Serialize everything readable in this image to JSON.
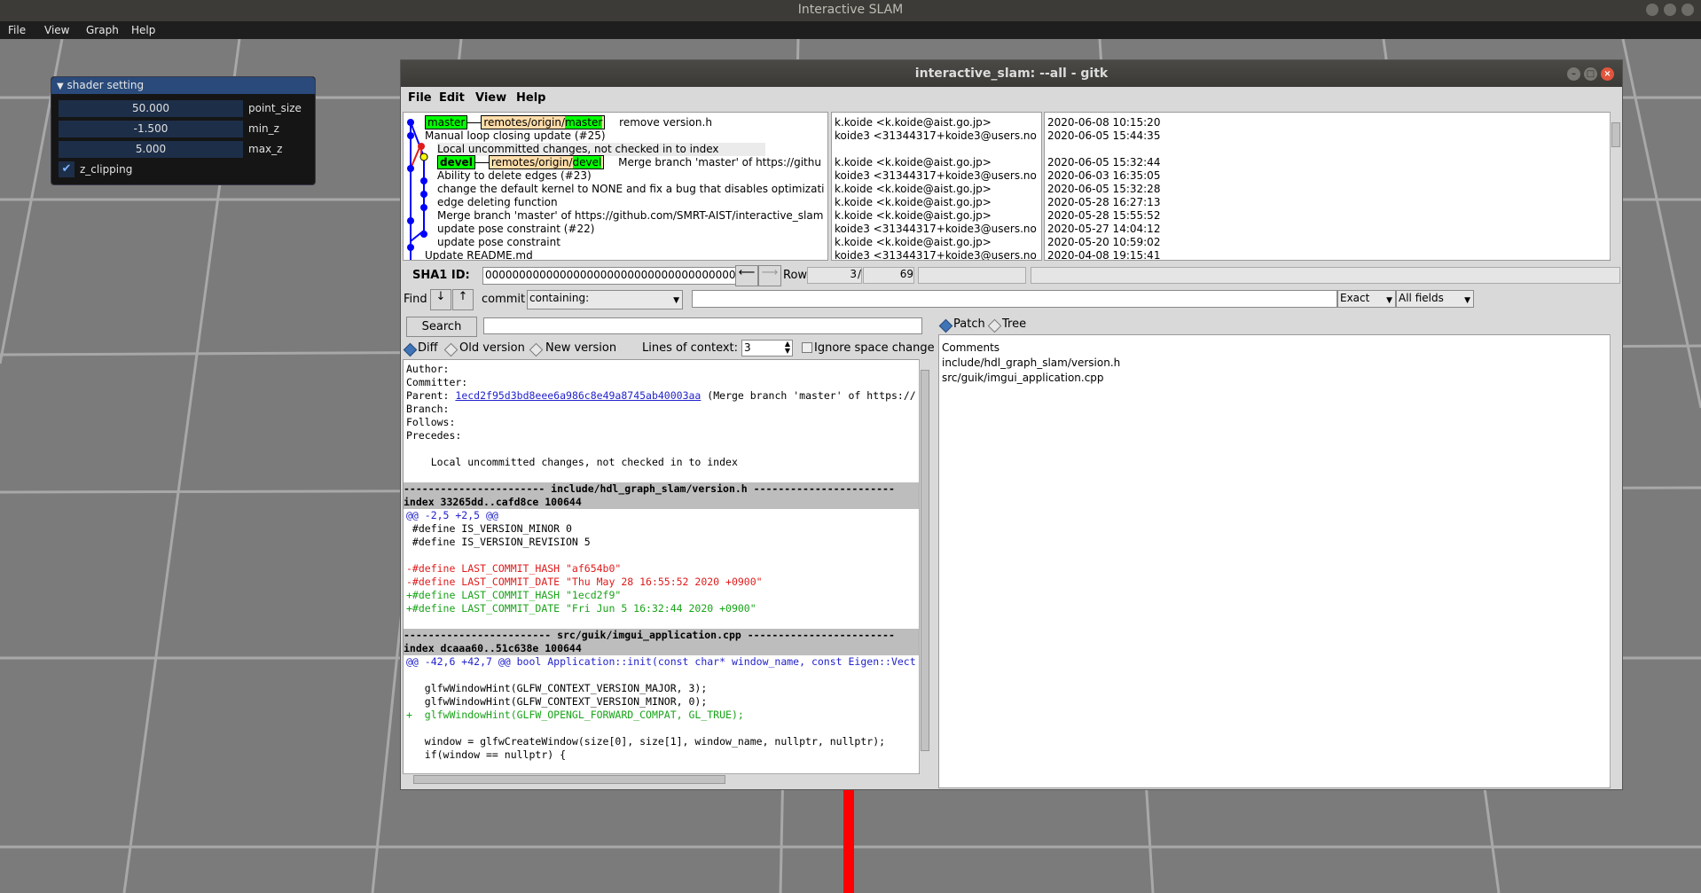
{
  "app": {
    "title": "Interactive SLAM",
    "menu": [
      "File",
      "View",
      "Graph",
      "Help"
    ]
  },
  "shader": {
    "title": "shader setting",
    "fields": [
      {
        "value": "50.000",
        "label": "point_size"
      },
      {
        "value": "-1.500",
        "label": "min_z"
      },
      {
        "value": "5.000",
        "label": "max_z"
      }
    ],
    "checkbox_label": "z_clipping"
  },
  "gitk": {
    "title": "interactive_slam: --all - gitk",
    "menu": [
      "File",
      "Edit",
      "View",
      "Help"
    ],
    "refs": {
      "master": "master",
      "remote_master_prefix": "remotes/origin/",
      "remote_master": "master",
      "devel": "devel",
      "remote_devel_prefix": "remotes/origin/",
      "remote_devel": "devel"
    },
    "commits": [
      "remove version.h",
      "Manual loop closing update (#25)",
      "Local uncommitted changes, not checked in to index",
      "Merge branch 'master' of https://githu",
      "Ability to delete edges (#23)",
      "change the default kernel to NONE and fix a bug that disables optimizati",
      "edge deleting function",
      "Merge branch 'master' of https://github.com/SMRT-AIST/interactive_slam",
      "update pose constraint (#22)",
      "update pose constraint",
      "Update README.md"
    ],
    "authors": [
      "k.koide <k.koide@aist.go.jp>",
      "koide3 <31344317+koide3@users.no",
      "",
      "k.koide <k.koide@aist.go.jp>",
      "koide3 <31344317+koide3@users.no",
      "k.koide <k.koide@aist.go.jp>",
      "k.koide <k.koide@aist.go.jp>",
      "k.koide <k.koide@aist.go.jp>",
      "koide3 <31344317+koide3@users.no",
      "k.koide <k.koide@aist.go.jp>",
      "koide3 <31344317+koide3@users.no"
    ],
    "dates": [
      "2020-06-08 10:15:20",
      "2020-06-05 15:44:35",
      "",
      "2020-06-05 15:32:44",
      "2020-06-03 16:35:05",
      "2020-06-05 15:32:28",
      "2020-05-28 16:27:13",
      "2020-05-28 15:55:52",
      "2020-05-27 14:04:12",
      "2020-05-20 10:59:02",
      "2020-04-08 19:15:41"
    ],
    "sha": {
      "label": "SHA1 ID:",
      "value": "0000000000000000000000000000000000000000",
      "row_label": "Row",
      "row_current": "3",
      "row_sep": "/",
      "row_total": "69"
    },
    "find": {
      "label": "Find",
      "commit_label": "commit",
      "mode": "containing:",
      "exact": "Exact",
      "fields": "All fields"
    },
    "search_button": "Search",
    "diff_options": {
      "diff": "Diff",
      "old": "Old version",
      "new": "New version",
      "context_label": "Lines of context:",
      "context_value": "3",
      "ignore_space": "Ignore space change"
    },
    "view_mode": {
      "patch": "Patch",
      "tree": "Tree"
    },
    "details": {
      "author": "Author:",
      "committer": "Committer:",
      "parent_label": "Parent:",
      "parent_hash": "1ecd2f95d3bd8eee6a986c8e49a8745ab40003aa",
      "parent_msg": "(Merge branch 'master' of https://",
      "branch": "Branch:",
      "follows": "Follows:",
      "precedes": "Precedes:",
      "message": "    Local uncommitted changes, not checked in to index"
    },
    "diff": {
      "file1_header": "----------------------- include/hdl_graph_slam/version.h -----------------------",
      "file1_index": "index 33265dd..cafd8ce 100644",
      "file1_hunk": "@@ -2,5 +2,5 @@",
      "file1_ctx1": " #define IS_VERSION_MINOR 0",
      "file1_ctx2": " #define IS_VERSION_REVISION 5",
      "file1_del1": "-#define LAST_COMMIT_HASH \"af654b0\"",
      "file1_del2": "-#define LAST_COMMIT_DATE \"Thu May 28 16:55:52 2020 +0900\"",
      "file1_add1": "+#define LAST_COMMIT_HASH \"1ecd2f9\"",
      "file1_add2": "+#define LAST_COMMIT_DATE \"Fri Jun 5 16:32:44 2020 +0900\"",
      "file2_header": "------------------------ src/guik/imgui_application.cpp ------------------------",
      "file2_index": "index dcaaa60..51c638e 100644",
      "file2_hunk": "@@ -42,6 +42,7 @@ bool Application::init(const char* window_name, const Eigen::Vect",
      "file2_ctx1": "   glfwWindowHint(GLFW_CONTEXT_VERSION_MAJOR, 3);",
      "file2_ctx2": "   glfwWindowHint(GLFW_CONTEXT_VERSION_MINOR, 0);",
      "file2_add1": "+  glfwWindowHint(GLFW_OPENGL_FORWARD_COMPAT, GL_TRUE);",
      "file2_ctx3": "   window = glfwCreateWindow(size[0], size[1], window_name, nullptr, nullptr);",
      "file2_ctx4": "   if(window == nullptr) {"
    },
    "files": [
      "Comments",
      "include/hdl_graph_slam/version.h",
      "src/guik/imgui_application.cpp"
    ]
  },
  "colors": {
    "ref_green": "#00ff00",
    "remote_orange": "#ffddaa",
    "commit_blue": "#0000ff",
    "uncommitted_red": "#e01b1b",
    "diff_del": "#e01b1b",
    "diff_add": "#19a319"
  }
}
